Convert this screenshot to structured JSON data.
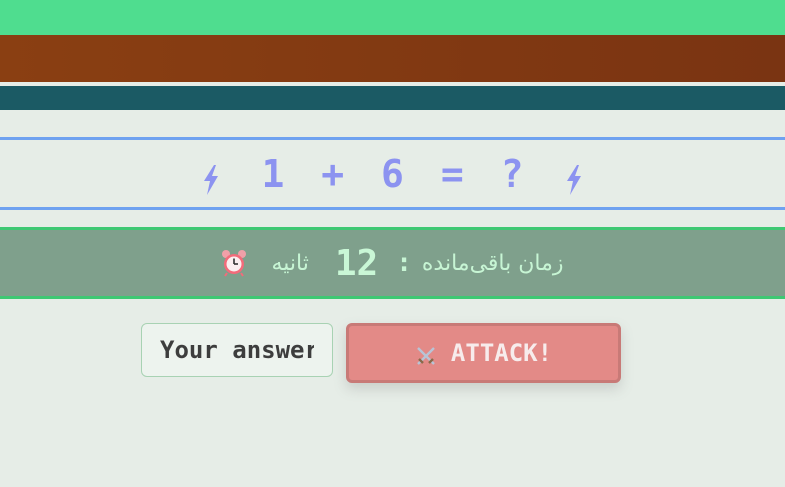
{
  "scene": {
    "colors": {
      "grass": "#4fdd8f",
      "dirt": "#8a3f12",
      "water": "#1b5a64",
      "equation_border": "#6fa2f0",
      "equation_text": "#8c93f0",
      "timer_bg": "#7fa08c",
      "timer_border": "#3ec873",
      "attack_bg": "#e38a87"
    }
  },
  "equation": {
    "text": "1 + 6 = ?",
    "left_icon": "lightning-bolt-icon",
    "right_icon": "lightning-bolt-icon"
  },
  "timer": {
    "label": "زمان باقی‌مانده",
    "colon": ":",
    "value": "12",
    "unit": "ثانیه",
    "icon": "alarm-clock-icon"
  },
  "answer": {
    "value": "",
    "placeholder": "Your answer"
  },
  "attack": {
    "icon": "crossed-swords-icon",
    "label": "ATTACK!"
  }
}
